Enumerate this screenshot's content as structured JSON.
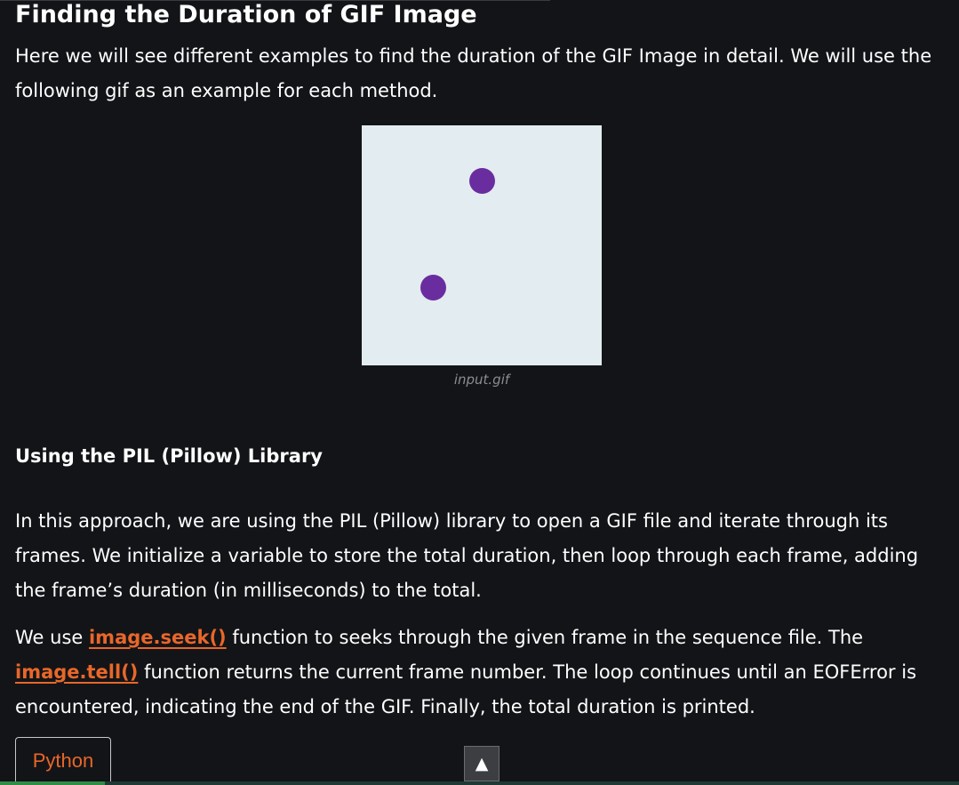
{
  "article": {
    "title": "Finding the Duration of GIF Image",
    "intro": "Here we will see different examples to find the duration of the GIF Image in detail. We will use the following gif as an example for each method.",
    "figure": {
      "caption": "input.gif",
      "background_color": "#e3ecf0",
      "dot_color": "#6a2da0"
    },
    "section_heading": "Using the PIL (Pillow) Library",
    "approach_text": "In this approach, we are using the PIL (Pillow) library to open a GIF file and iterate through its frames. We initialize a variable to store the total duration, then loop through each frame, adding the frame’s duration (in milliseconds) to the total.",
    "usage": {
      "prefix": "We use ",
      "seek_link": "image.seek()",
      "middle": " function to seeks through the given frame in the sequence file. The ",
      "tell_link": "image.tell()",
      "suffix": " function returns the current frame number. The loop continues until an EOFError is encountered, indicating the end of the GIF. Finally, the total duration is printed."
    },
    "code_tab_label": "Python"
  },
  "scroll_top": {
    "icon": "triangle-up-icon",
    "glyph": "▲"
  },
  "colors": {
    "background": "#131417",
    "text": "#ffffff",
    "link": "#e8672a",
    "accent_green": "#2f8d46"
  }
}
